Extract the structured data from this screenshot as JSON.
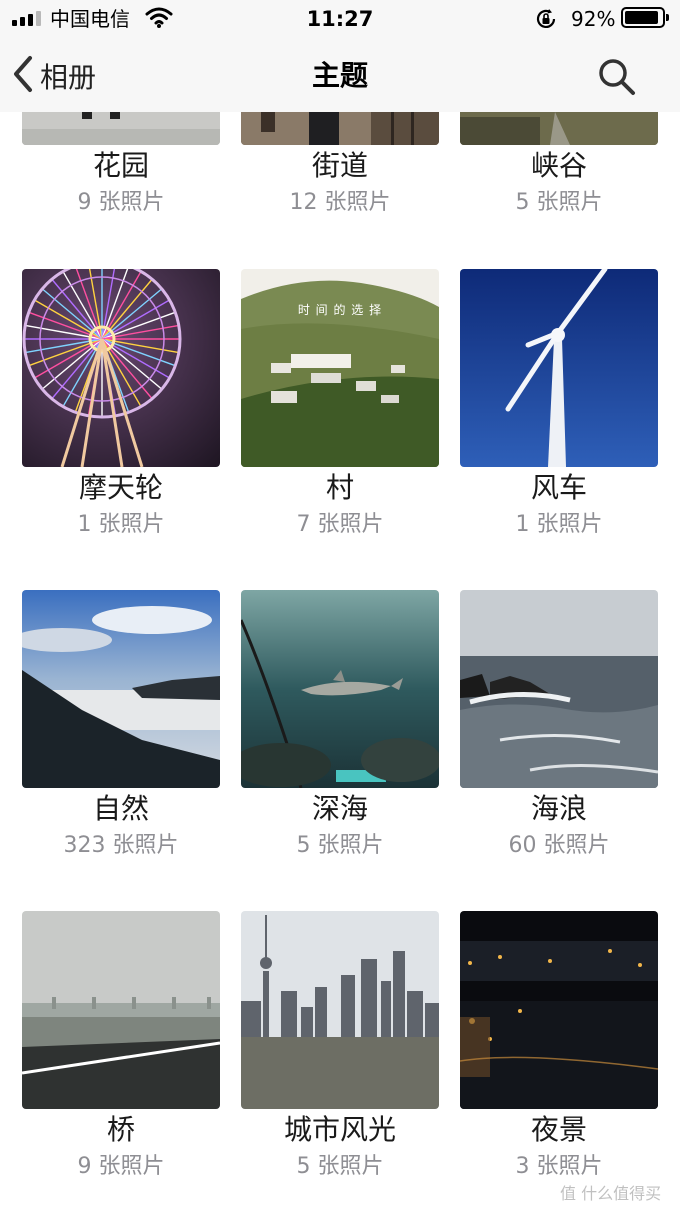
{
  "status_bar": {
    "carrier": "中国电信",
    "time": "11:27",
    "battery_percent": "92%",
    "battery_level": 0.92
  },
  "nav": {
    "back_label": "相册",
    "title": "主题"
  },
  "albums": [
    {
      "title": "花园",
      "count": "9 张照片"
    },
    {
      "title": "街道",
      "count": "12 张照片"
    },
    {
      "title": "峡谷",
      "count": "5 张照片"
    },
    {
      "title": "摩天轮",
      "count": "1 张照片"
    },
    {
      "title": "村",
      "count": "7 张照片",
      "overlay_text": "时 间 的 选 择"
    },
    {
      "title": "风车",
      "count": "1 张照片"
    },
    {
      "title": "自然",
      "count": "323 张照片"
    },
    {
      "title": "深海",
      "count": "5 张照片"
    },
    {
      "title": "海浪",
      "count": "60 张照片"
    },
    {
      "title": "桥",
      "count": "9 张照片"
    },
    {
      "title": "城市风光",
      "count": "5 张照片"
    },
    {
      "title": "夜景",
      "count": "3 张照片"
    }
  ],
  "watermark": "值 什么值得买",
  "icons": {
    "back": "chevron-left-icon",
    "search": "search-icon",
    "wifi": "wifi-icon",
    "rotation_lock": "rotation-lock-icon",
    "battery": "battery-icon",
    "signal": "cellular-signal-icon"
  }
}
